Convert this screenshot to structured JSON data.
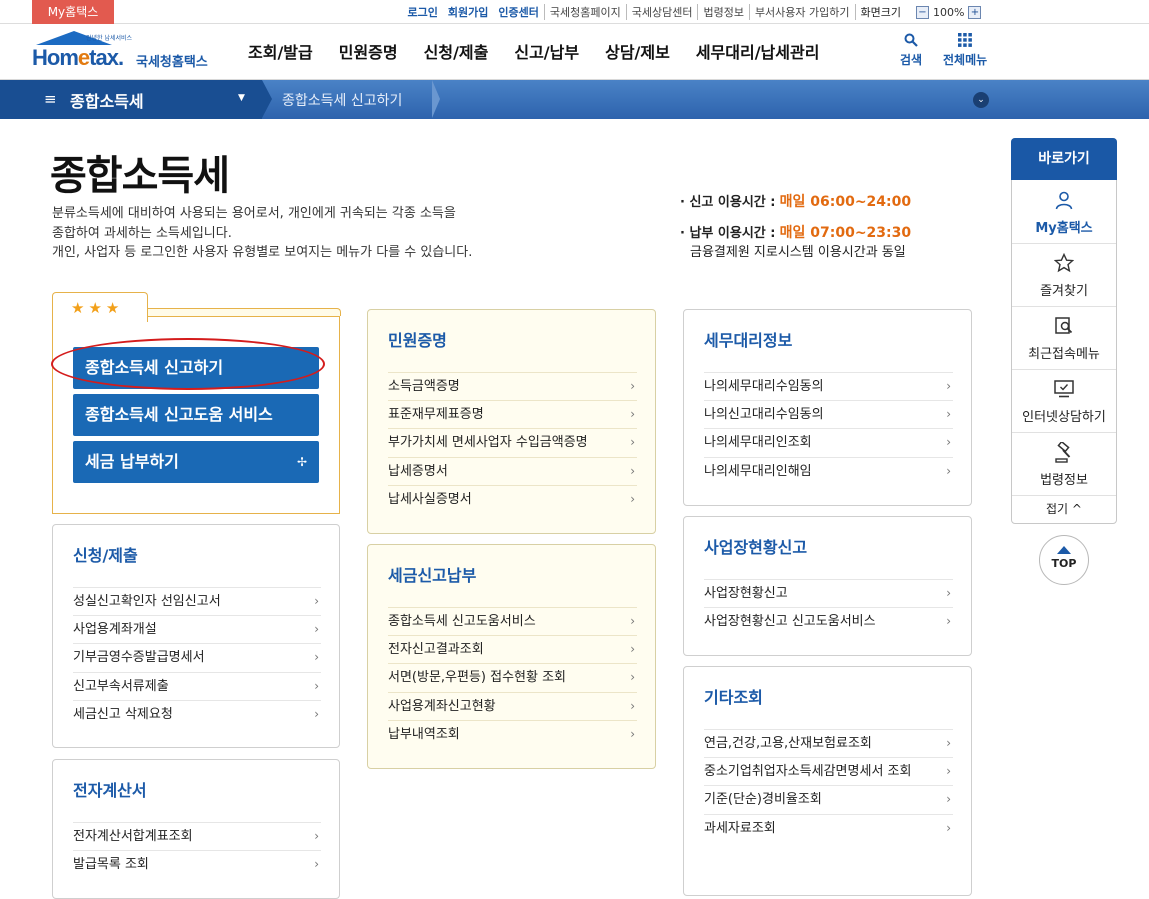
{
  "topbar": {
    "myhome": "My홈택스",
    "util_links": [
      "로그인",
      "회원가입",
      "인증센터",
      "국세청홈페이지",
      "국세상담센터",
      "법령정보",
      "부서사용자 가입하기",
      "화면크기"
    ],
    "zoom_minus": "−",
    "zoom_value": "100%",
    "zoom_plus": "+"
  },
  "header": {
    "logo_brand_a": "Hom",
    "logo_brand_e": "e",
    "logo_brand_b": "tax.",
    "logo_tiny": "안녕한 납세서비스",
    "logo_sub": "국세청홈택스",
    "gnb": [
      "조회/발급",
      "민원증명",
      "신청/제출",
      "신고/납부",
      "상담/제보",
      "세무대리/납세관리"
    ],
    "search_label": "검색",
    "allmenu_label": "전체메뉴",
    "icons": {
      "search": "search-icon",
      "allmenu": "grid-icon"
    }
  },
  "navbar": {
    "current": "종합소득세",
    "crumb": "종합소득세 신고하기"
  },
  "page": {
    "title": "종합소득세",
    "desc": [
      "분류소득세에 대비하여 사용되는 용어로서, 개인에게 귀속되는 각종 소득을",
      "종합하여 과세하는 소득세입니다.",
      "개인, 사업자 등 로그인한 사용자 유형별로 보여지는 메뉴가 다를 수 있습니다."
    ],
    "report_time_label": "· 신고 이용시간 :",
    "report_time_value": "매일 06:00~24:00",
    "pay_time_label": "· 납부 이용시간 :",
    "pay_time_value": "매일 07:00~23:30",
    "pay_time_note": "금융결제원 지로시스템 이용시간과 동일"
  },
  "favorites": {
    "stars": "★★★",
    "buttons": [
      "종합소득세 신고하기",
      "종합소득세 신고도움 서비스",
      "세금 납부하기"
    ],
    "plus": "✢"
  },
  "cards": {
    "apply": {
      "title": "신청/제출",
      "items": [
        "성실신고확인자 선임신고서",
        "사업용계좌개설",
        "기부금영수증발급명세서",
        "신고부속서류제출",
        "세금신고 삭제요청"
      ]
    },
    "einvoice": {
      "title": "전자계산서",
      "items": [
        "전자계산서합계표조회",
        "발급목록 조회"
      ]
    },
    "cert": {
      "title": "민원증명",
      "items": [
        "소득금액증명",
        "표준재무제표증명",
        "부가가치세 면세사업자 수입금액증명",
        "납세증명서",
        "납세사실증명서"
      ]
    },
    "taxpay": {
      "title": "세금신고납부",
      "items": [
        "종합소득세 신고도움서비스",
        "전자신고결과조회",
        "서면(방문,우편등) 접수현황 조회",
        "사업용계좌신고현황",
        "납부내역조회"
      ]
    },
    "agent": {
      "title": "세무대리정보",
      "items": [
        "나의세무대리수임동의",
        "나의신고대리수임동의",
        "나의세무대리인조회",
        "나의세무대리인해임"
      ]
    },
    "biz": {
      "title": "사업장현황신고",
      "items": [
        "사업장현황신고",
        "사업장현황신고 신고도움서비스"
      ]
    },
    "etc": {
      "title": "기타조회",
      "items": [
        "연금,건강,고용,산재보험료조회",
        "중소기업취업자소득세감면명세서 조회",
        "기준(단순)경비율조회",
        "과세자료조회"
      ]
    },
    "chevron": "›"
  },
  "quickmenu": {
    "title": "바로가기",
    "items": [
      {
        "label": "My홈택스",
        "icon": "person-icon"
      },
      {
        "label": "즐겨찾기",
        "icon": "star-icon"
      },
      {
        "label": "최근접속메뉴",
        "icon": "recent-search-icon"
      },
      {
        "label": "인터넷상담하기",
        "icon": "monitor-chat-icon"
      },
      {
        "label": "법령정보",
        "icon": "gavel-icon"
      }
    ],
    "fold": "접기 ^",
    "top": "TOP"
  }
}
